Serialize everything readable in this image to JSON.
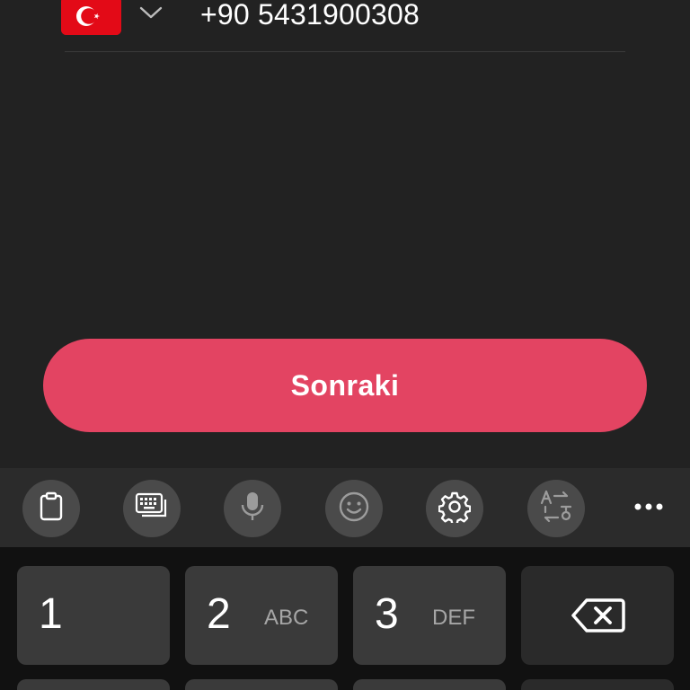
{
  "phone": {
    "country_icon": "turkey-flag-icon",
    "dropdown_icon": "chevron-down-icon",
    "number": "+90 5431900308"
  },
  "next_button": {
    "label": "Sonraki",
    "color": "#e34462"
  },
  "keyboard_toolbar": {
    "items": [
      {
        "name": "clipboard-icon",
        "enabled": true
      },
      {
        "name": "keyboard-layout-icon",
        "enabled": true
      },
      {
        "name": "microphone-icon",
        "enabled": false
      },
      {
        "name": "emoji-icon",
        "enabled": false
      },
      {
        "name": "gear-icon",
        "enabled": true
      },
      {
        "name": "translate-icon",
        "enabled": false
      },
      {
        "name": "more-options-icon",
        "enabled": true
      }
    ]
  },
  "keypad": {
    "keys": [
      {
        "digit": "1",
        "letters": ""
      },
      {
        "digit": "2",
        "letters": "ABC"
      },
      {
        "digit": "3",
        "letters": "DEF"
      },
      {
        "digit": "",
        "letters": "",
        "icon": "backspace-icon"
      }
    ]
  },
  "colors": {
    "background": "#222222",
    "toolbar": "#2b2b2b",
    "keyboard": "#111111",
    "key": "#3a3a3a"
  }
}
